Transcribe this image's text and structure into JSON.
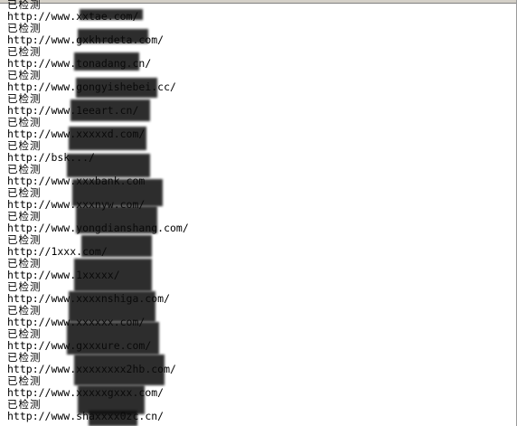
{
  "log_lines": [
    "已检测",
    "http://www.xxtae.com/",
    "已检测",
    "http://www.gxkhrdeta.com/",
    "已检测",
    "http://www.tonadang.cn/",
    "已检测",
    "http://www.gongyishebei.cc/",
    "已检测",
    "http://www.1eeart.cn/",
    "已检测",
    "http://www.xxxxxd.com/",
    "已检测",
    "http://bsk.../",
    "已检测",
    "http://www.xxxbank.com",
    "已检测",
    "http://www.xxxnyw.com/",
    "已检测",
    "http://www.yongdianshang.com/",
    "已检测",
    "http://1xxx.com/",
    "已检测",
    "http://www.1xxxxx/",
    "已检测",
    "http://www.xxxxnshiga.com/",
    "已检测",
    "http://www.xxxxxx.com/",
    "已检测",
    "http://www.gxxxure.com/",
    "已检测",
    "http://www.xxxxxxxx2hb.com/",
    "已检测",
    "http://www.xxxxxgxxx.com/",
    "已检测",
    "http://www.shaxxxx0zc.cn/"
  ]
}
